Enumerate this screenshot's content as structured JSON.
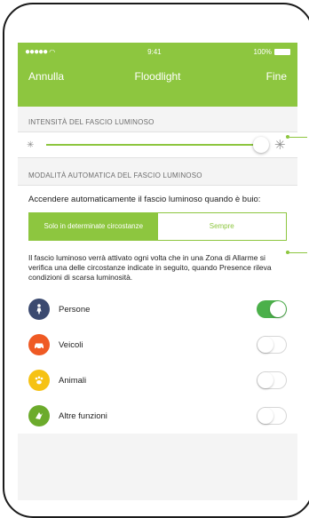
{
  "status_bar": {
    "carrier_dots": "●●●●●",
    "time": "9:41",
    "battery_percent": "100%"
  },
  "nav": {
    "left": "Annulla",
    "title": "Floodlight",
    "right": "Fine"
  },
  "intensity": {
    "header": "INTENSITÀ DEL FASCIO LUMINOSO",
    "slider_value": 1.0
  },
  "auto_mode": {
    "header": "MODALITÀ AUTOMATICA DEL FASCIO LUMINOSO",
    "prompt": "Accendere automaticamente il fascio luminoso quando è buio:",
    "options": [
      {
        "label": "Solo in determinate circostanze",
        "selected": true
      },
      {
        "label": "Sempre",
        "selected": false
      }
    ],
    "description": "Il fascio luminoso verrà attivato ogni volta che in una Zona di Allarme si verifica una delle circostanze indicate in seguito, quando Presence rileva condizioni di scarsa luminosità."
  },
  "items": [
    {
      "label": "Persone",
      "icon": "person-icon",
      "color": "#3b4a70",
      "on": true
    },
    {
      "label": "Veicoli",
      "icon": "car-icon",
      "color": "#ef5a24",
      "on": false
    },
    {
      "label": "Animali",
      "icon": "paw-icon",
      "color": "#f6c214",
      "on": false
    },
    {
      "label": "Altre funzioni",
      "icon": "misc-icon",
      "color": "#6cab2c",
      "on": false
    }
  ],
  "colors": {
    "accent": "#8dc63f",
    "toggle_on": "#4bb04a"
  }
}
